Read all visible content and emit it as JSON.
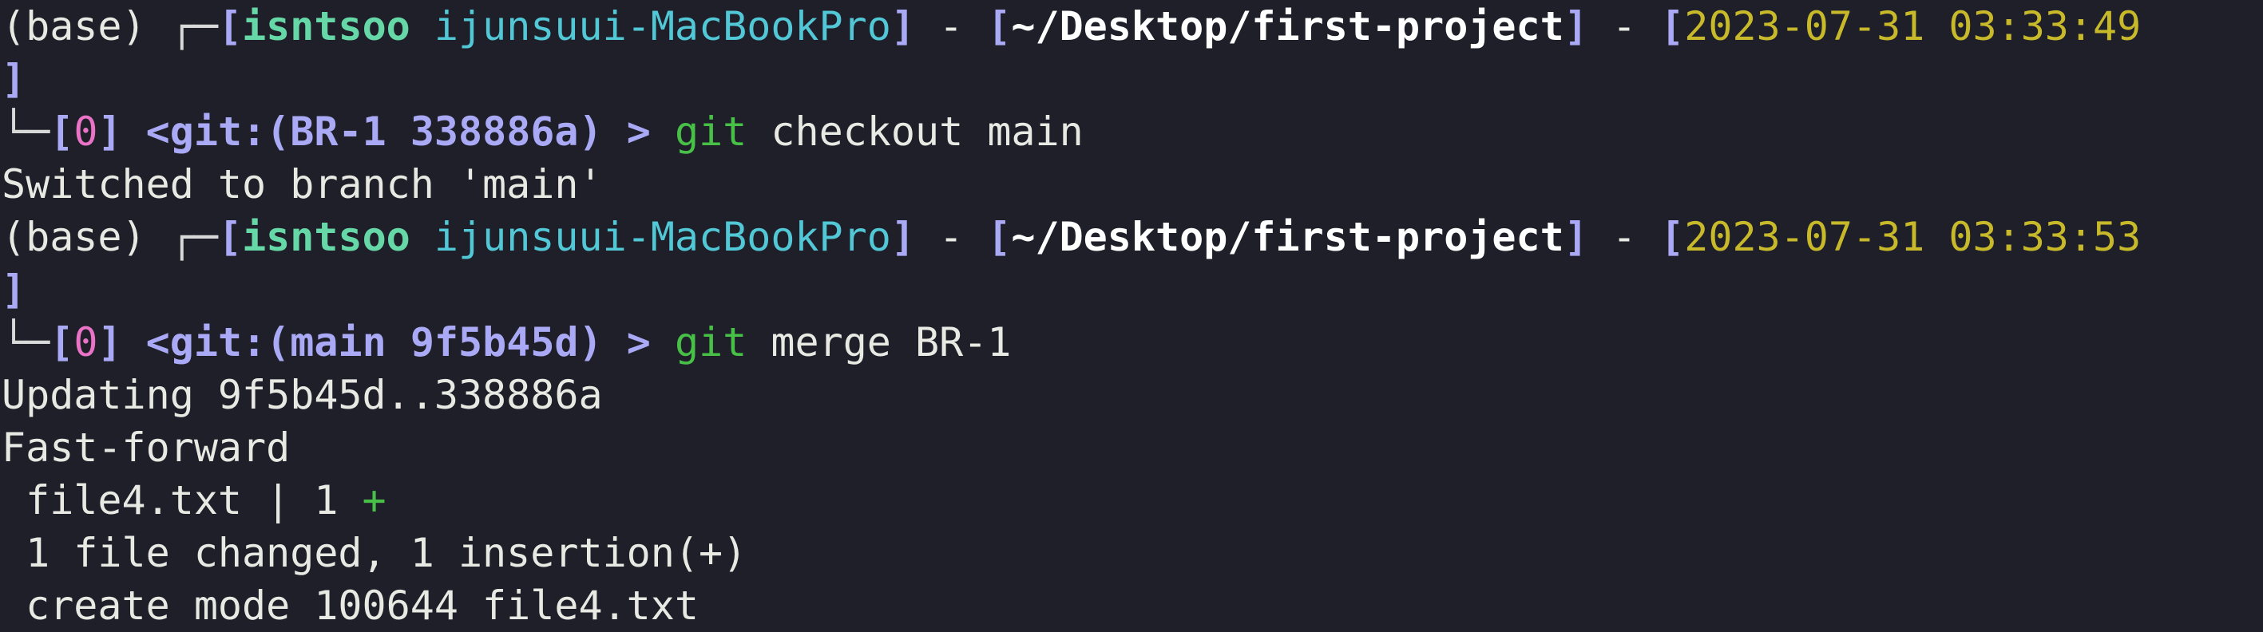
{
  "window": {
    "background": "#1e1f29"
  },
  "colors": {
    "bracket": "#a9a9f5",
    "user": "#66d8a7",
    "host": "#52c7d6",
    "date": "#c7b92a",
    "job": "#e974c7",
    "git_command": "#48c048"
  },
  "prompt1": {
    "env": "(base)",
    "corner_top": "┌─",
    "user": "isntsoo",
    "host": "ijunsuui-MacBookPro",
    "sep": " - ",
    "path": "~/Desktop/first-project",
    "datetime": "2023-07-31 03:33:49",
    "close_bracket": "]",
    "corner_bottom": "└─",
    "job": "0",
    "git_branch": "BR-1",
    "git_hash": "338886a",
    "arrow": ">",
    "cmd_name": "git",
    "cmd_args": "checkout main"
  },
  "output1": [
    "Switched to branch 'main'"
  ],
  "prompt2": {
    "env": "(base)",
    "corner_top": "┌─",
    "user": "isntsoo",
    "host": "ijunsuui-MacBookPro",
    "sep": " - ",
    "path": "~/Desktop/first-project",
    "datetime": "2023-07-31 03:33:53",
    "close_bracket": "]",
    "corner_bottom": "└─",
    "job": "0",
    "git_branch": "main",
    "git_hash": "9f5b45d",
    "arrow": ">",
    "cmd_name": "git",
    "cmd_args": "merge BR-1"
  },
  "output2": {
    "updating": "Updating 9f5b45d..338886a",
    "fast_forward": "Fast-forward",
    "stat_file": " file4.txt | 1 ",
    "stat_plus": "+",
    "summary": " 1 file changed, 1 insertion(+)",
    "create": " create mode 100644 file4.txt"
  }
}
